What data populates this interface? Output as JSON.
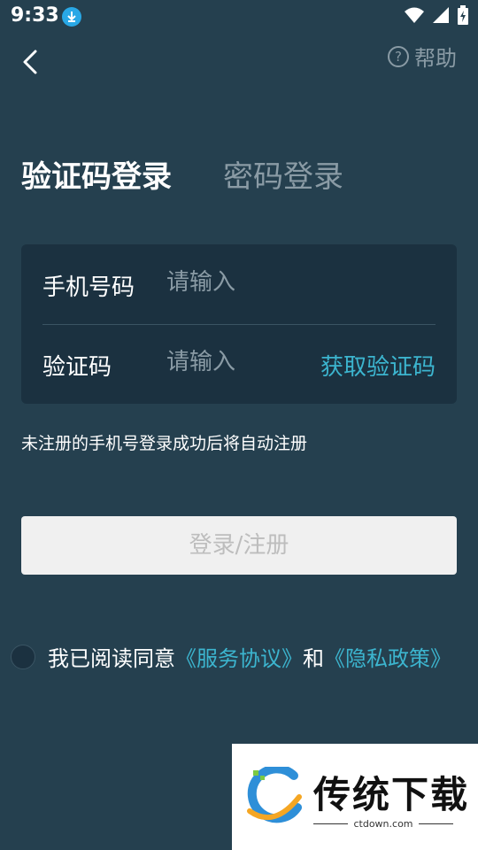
{
  "status_bar": {
    "time": "9:33"
  },
  "header": {
    "help_label": "帮助"
  },
  "tabs": [
    {
      "label": "验证码登录",
      "active": true
    },
    {
      "label": "密码登录",
      "active": false
    }
  ],
  "form": {
    "phone": {
      "label": "手机号码",
      "placeholder": "请输入"
    },
    "code": {
      "label": "验证码",
      "placeholder": "请输入"
    },
    "get_code_label": "获取验证码"
  },
  "hint": "未注册的手机号登录成功后将自动注册",
  "login_button": "登录/注册",
  "agreement": {
    "prefix": "我已阅读同意",
    "service_link": "《服务协议》",
    "and": "和",
    "privacy_link": "《隐私政策》"
  },
  "watermark": {
    "title": "传统下载",
    "subtitle": "ctdown.com"
  },
  "colors": {
    "background": "#25404f",
    "card": "#1b3140",
    "accent": "#3cb5cf",
    "muted": "#8a9ba5"
  }
}
